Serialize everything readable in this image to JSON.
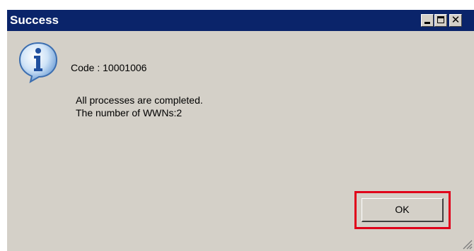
{
  "window": {
    "title": "Success",
    "close_glyph": "✕"
  },
  "icons": {
    "info": "info-icon",
    "minimize": "minimize-icon",
    "maximize": "maximize-icon",
    "close": "close-icon",
    "resize": "resize-grip-icon"
  },
  "message": {
    "code": "Code : 10001006",
    "line1": "All processes are completed.",
    "line2": "The number of WWNs:2"
  },
  "buttons": {
    "ok_label": "OK"
  },
  "colors": {
    "titlebar": "#0a246a",
    "dialog_bg": "#d4d0c8",
    "highlight": "#e0001a"
  }
}
